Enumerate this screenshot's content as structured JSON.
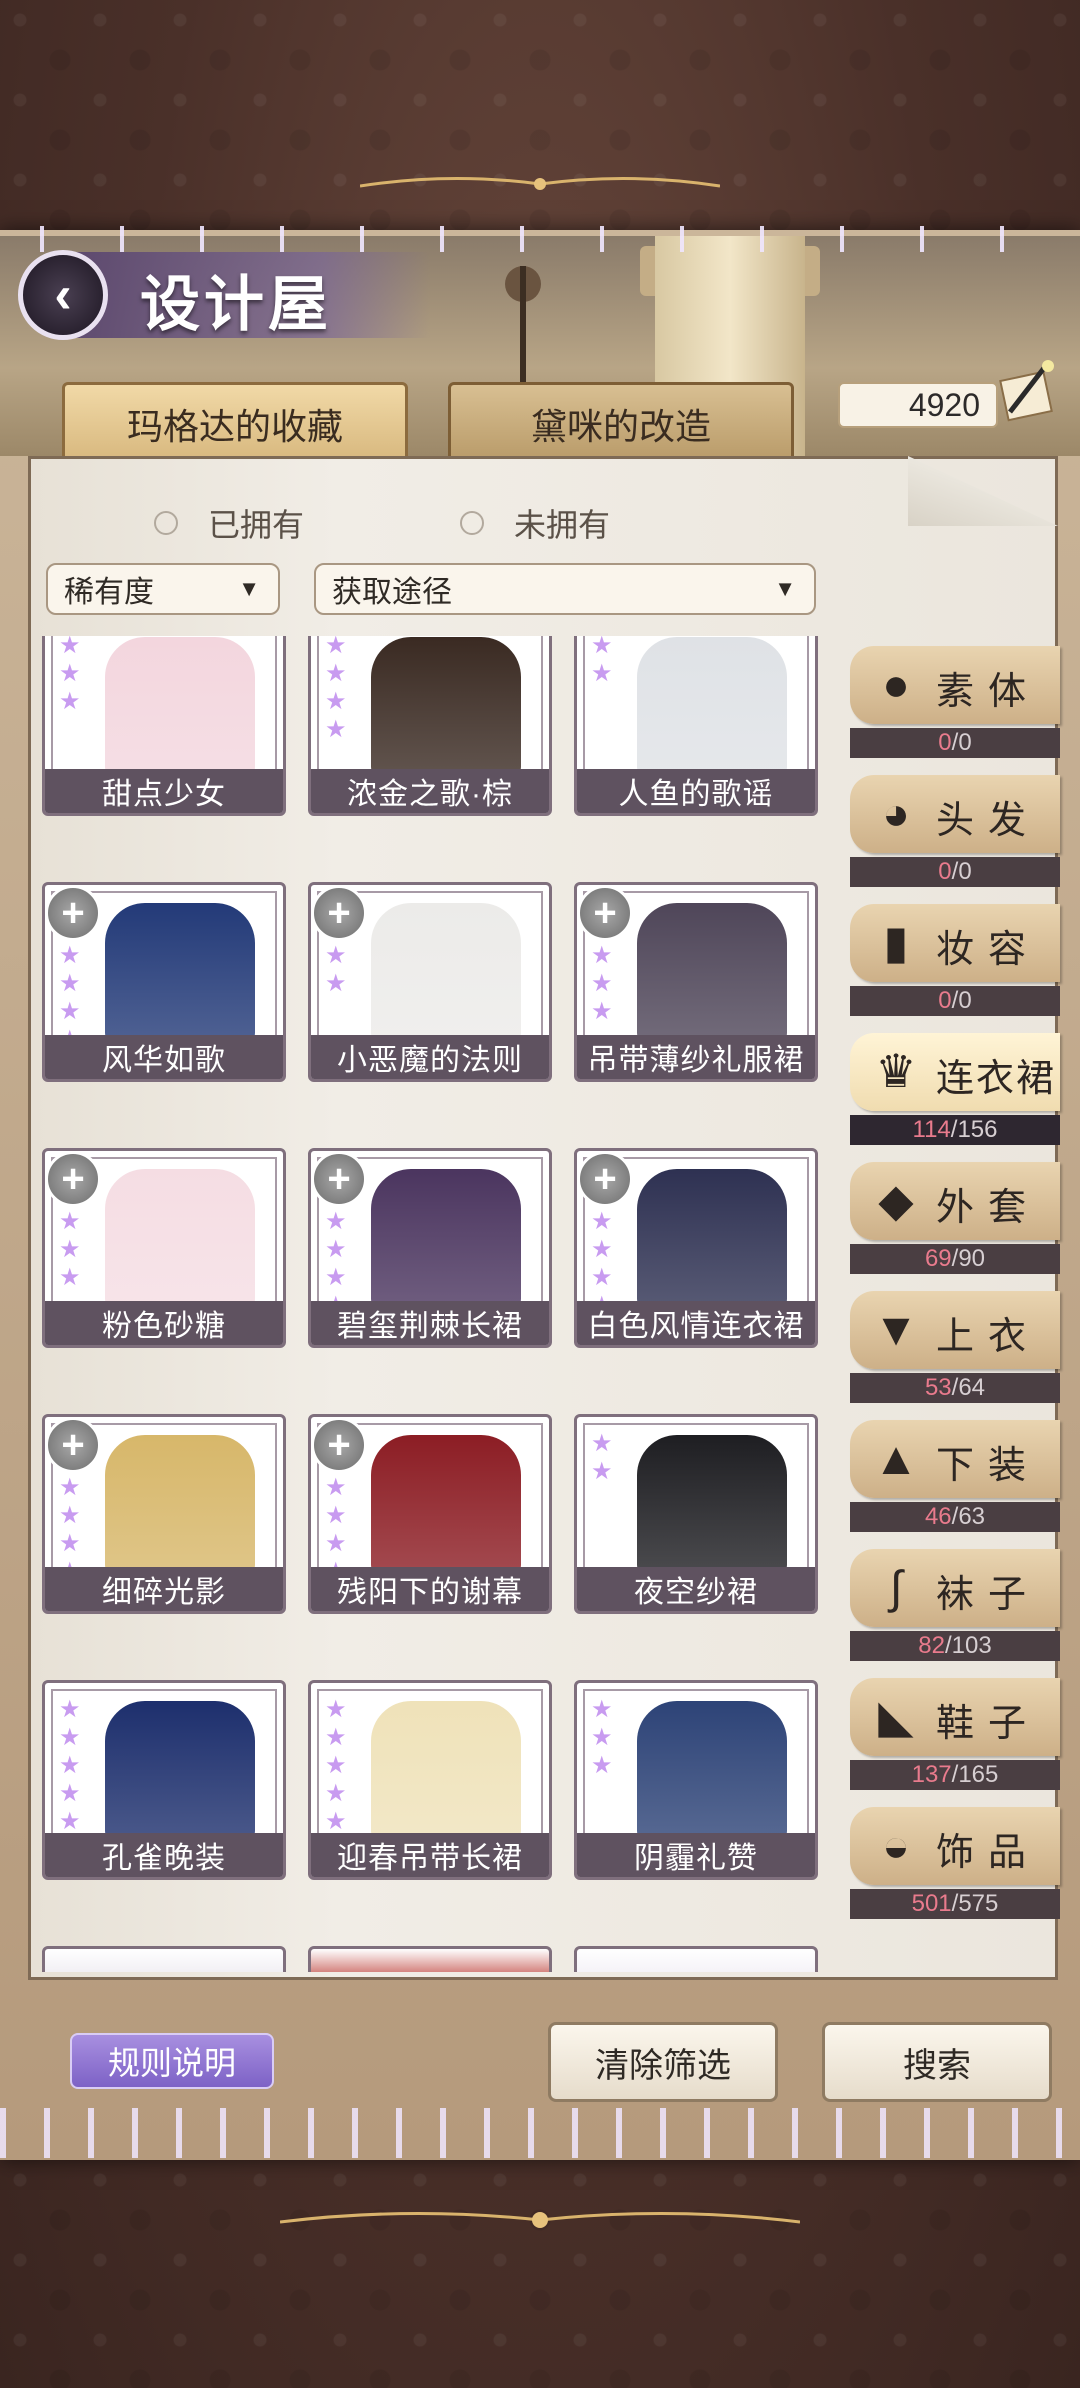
{
  "header": {
    "title": "设计屋",
    "currency_value": "4920"
  },
  "tabs": [
    {
      "label": "玛格达的收藏"
    },
    {
      "label": "黛咪的改造"
    }
  ],
  "filters": {
    "radio_owned": "已拥有",
    "radio_unowned": "未拥有",
    "rarity_dropdown": "稀有度",
    "source_dropdown": "获取途径"
  },
  "items": [
    {
      "name": "甜点少女",
      "stars": 3,
      "plus": false,
      "color": "#f3d6de"
    },
    {
      "name": "浓金之歌·棕",
      "stars": 4,
      "plus": false,
      "color": "#3a2a22"
    },
    {
      "name": "人鱼的歌谣",
      "stars": 2,
      "plus": false,
      "color": "#dfe2e6"
    },
    {
      "name": "风华如歌",
      "stars": 4,
      "plus": true,
      "color": "#233a78"
    },
    {
      "name": "小恶魔的法则",
      "stars": 2,
      "plus": true,
      "color": "#ecebe9"
    },
    {
      "name": "吊带薄纱礼服裙",
      "stars": 3,
      "plus": true,
      "color": "#4f4659"
    },
    {
      "name": "粉色砂糖",
      "stars": 3,
      "plus": true,
      "color": "#f5dde3"
    },
    {
      "name": "碧玺荆棘长裙",
      "stars": 5,
      "plus": true,
      "color": "#4b355f"
    },
    {
      "name": "白色风情连衣裙",
      "stars": 5,
      "plus": true,
      "color": "#2e3152"
    },
    {
      "name": "细碎光影",
      "stars": 4,
      "plus": true,
      "color": "#d7b76a"
    },
    {
      "name": "残阳下的谢幕",
      "stars": 5,
      "plus": true,
      "color": "#8c1d24"
    },
    {
      "name": "夜空纱裙",
      "stars": 2,
      "plus": false,
      "color": "#1e1e22"
    },
    {
      "name": "孔雀晚装",
      "stars": 6,
      "plus": false,
      "color": "#1d2f6d"
    },
    {
      "name": "迎春吊带长裙",
      "stars": 5,
      "plus": false,
      "color": "#efe2b9"
    },
    {
      "name": "阴霾礼赞",
      "stars": 3,
      "plus": false,
      "color": "#2d4377"
    }
  ],
  "partial_row_colors": [
    "#e8e4ec",
    "#b52a22",
    "#eeeaf2"
  ],
  "categories": [
    {
      "name": "素体",
      "owned": "0",
      "total": "0",
      "icon": "silhouette-icon",
      "glyph": "●"
    },
    {
      "name": "头发",
      "owned": "0",
      "total": "0",
      "icon": "hair-icon",
      "glyph": "◕"
    },
    {
      "name": "妆容",
      "owned": "0",
      "total": "0",
      "icon": "lipstick-icon",
      "glyph": "▮"
    },
    {
      "name": "连衣裙",
      "owned": "114",
      "total": "156",
      "icon": "dress-icon",
      "glyph": "♛"
    },
    {
      "name": "外套",
      "owned": "69",
      "total": "90",
      "icon": "coat-icon",
      "glyph": "◆"
    },
    {
      "name": "上衣",
      "owned": "53",
      "total": "64",
      "icon": "shirt-icon",
      "glyph": "▼"
    },
    {
      "name": "下装",
      "owned": "46",
      "total": "63",
      "icon": "skirt-icon",
      "glyph": "▲"
    },
    {
      "name": "袜子",
      "owned": "82",
      "total": "103",
      "icon": "socks-icon",
      "glyph": "∫"
    },
    {
      "name": "鞋子",
      "owned": "137",
      "total": "165",
      "icon": "shoe-icon",
      "glyph": "◣"
    },
    {
      "name": "饰品",
      "owned": "501",
      "total": "575",
      "icon": "hat-icon",
      "glyph": "◒"
    }
  ],
  "actions": {
    "rules": "规则说明",
    "clear": "清除筛选",
    "search": "搜索"
  },
  "colors": {
    "accent_purple": "#8c70d4",
    "label_bg": "#5f5260",
    "star": "#c89bf0",
    "owned_count": "#e97b8d"
  }
}
